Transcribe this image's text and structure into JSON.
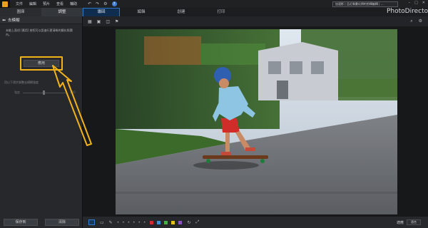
{
  "app": {
    "brand": "PhotoDirector",
    "menu": [
      "文件",
      "編輯",
      "預片",
      "查看",
      "輔助"
    ],
    "notice": "加速影 | 品近像畫化預約剪輯編輯 | …",
    "window_controls": [
      "–",
      "□",
      "✕"
    ]
  },
  "left_tabs": [
    {
      "label": "圖庫",
      "active": false
    },
    {
      "label": "調整",
      "active": true
    }
  ],
  "right_tabs": [
    {
      "label": "導回",
      "active": true
    },
    {
      "label": "編輯",
      "active": false
    },
    {
      "label": "創建",
      "active": false
    },
    {
      "label": "打印",
      "active": false
    }
  ],
  "left_panel": {
    "title": "去模糊",
    "description": "未能上直叨 [應用] 按招可以設進行更清晰的鏡化照瀾內。",
    "apply_label": "應用",
    "hint": "用以下滑步調整去模糊強度",
    "slider": {
      "left_label": "強度",
      "right_label": "100",
      "value": 50
    },
    "save_label": "保存到",
    "clear_label": "清除"
  },
  "toolbar": {
    "left_icons": [
      "layout-grid-icon",
      "image-view-icon",
      "compare-icon",
      "flag-icon"
    ],
    "right_icons": [
      "search-icon",
      "settings-icon"
    ]
  },
  "bottombar": {
    "swatch_colors": [
      "#d12c2c",
      "#3b8fd6",
      "#48b04a",
      "#e3c21e",
      "#8f4fc5"
    ],
    "dots": "• • • • • •",
    "zoom_label": "適應",
    "zoom_value": "適合"
  },
  "colors": {
    "accent": "#2e74c4",
    "highlight": "#f2b21a"
  }
}
